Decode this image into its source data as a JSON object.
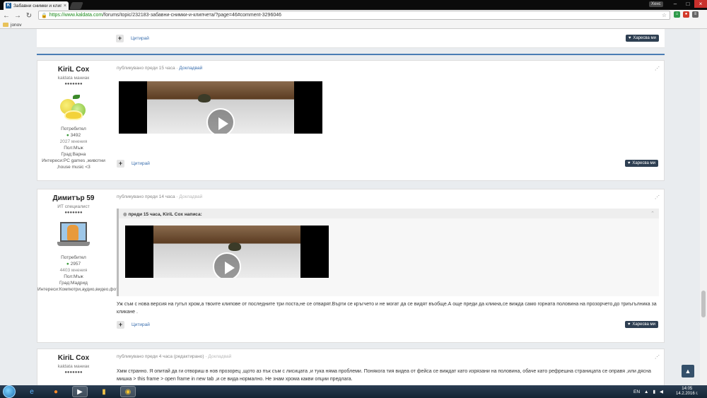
{
  "browser": {
    "tab_title": "Забавни снимки и клипчета",
    "tab_favicon": "K",
    "user": "Хенс",
    "url_scheme": "https://",
    "url_host": "www.kaldata.com",
    "url_path": "/forums/topic/232183-забавни-снимки-и-клипчета/?page=46#comment-3296046",
    "bookmark_folder": "jonov"
  },
  "labels": {
    "quote": "Цитирай",
    "like": "Харесва ми",
    "report": "Докладвай"
  },
  "posts": [
    {
      "author": "KiriL Cox",
      "rank": "kaldata маниак",
      "pips": "●●●●●●●",
      "group": "Потребител",
      "reputation": "3492",
      "count": "2027 мнения",
      "gender": "Пол:Мъж",
      "city": "Град:Варна",
      "interests": "Интереси:PC games ,животни ,house music <3",
      "published": "публикувано преди 15 часа"
    },
    {
      "author": "Димитър 59",
      "rank": "ИТ специалист",
      "pips": "●●●●●●●",
      "group": "Потребител",
      "reputation": "2957",
      "count": "4403 мнения",
      "gender": "Пол:Мъж",
      "city": "Град:Мадрид",
      "interests": "Интереси:Компютри,аудио,видео,фото",
      "published": "публикувано преди 14 часа",
      "quote_header": "преди 15 часа, KiriL Cox написа:",
      "text": "Уж съм с нова версия на гугъл хром,а твоите клипове от последните три поста,не се отварят.Върти се кръгчето и не могат да се видят въобще.А още преди да кликна,се вижда само горната половина на прозорчето,до триъгълника за кликане ."
    },
    {
      "author": "KiriL Cox",
      "rank": "kaldata маниак",
      "pips": "●●●●●●●",
      "published": "публикувано преди 4 часа (редактирано)",
      "text": "Хмм странно. Я опитай да ги отвориш в нов прозорец ,щото аз пък съм с лисицата ,и тука няма  проблеми. Понякога тия видеа от фейса се виждат като изрязани на половина, обаче като рефрешна страницата се оправя ,или дясна мишка > this frame > open frame in new tab ,и се вида нормално. Не знам хрома какви опции предлага."
    }
  ],
  "taskbar": {
    "lang": "EN",
    "time": "14:05",
    "date": "14.2.2016 г."
  },
  "colors": {
    "accent": "#4a7db5",
    "like_button": "#2e3f52",
    "link": "#3b6fae"
  }
}
